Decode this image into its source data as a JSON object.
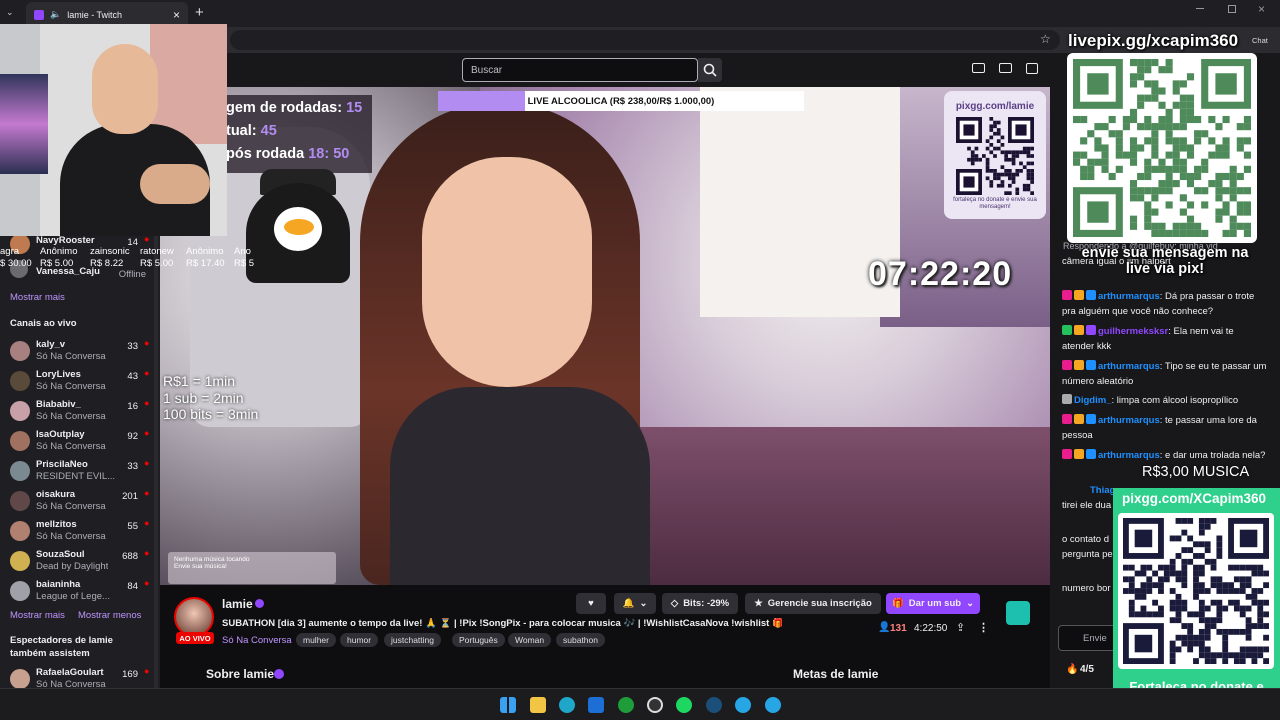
{
  "browser": {
    "tab_title": "lamie - Twitch",
    "new_tab": "+",
    "close": "×"
  },
  "nav": {
    "search_placeholder": "Buscar",
    "chat_label": "Chat"
  },
  "donors": {
    "names": [
      "agra",
      "Anônimo",
      "zainsonic",
      "ratonew",
      "Anônimo",
      "Ano"
    ],
    "amounts": [
      "$ 30.00",
      "R$ 5.00",
      "R$ 8.22",
      "R$ 5.00",
      "R$ 17.40",
      "R$ 5"
    ]
  },
  "sidebar": {
    "followed": [
      {
        "name": "NavyRooster",
        "count": "14"
      },
      {
        "name": "Vanessa_Caju",
        "status": "Offline"
      }
    ],
    "show_more_1": "Mostrar mais",
    "live_title": "Canais ao vivo",
    "live": [
      {
        "name": "kaly_v",
        "game": "Só Na Conversa",
        "count": "33",
        "color": "#a98080"
      },
      {
        "name": "LoryLives",
        "game": "Só Na Conversa",
        "count": "43",
        "color": "#5a4a3a"
      },
      {
        "name": "Biababiv_",
        "game": "Só Na Conversa",
        "count": "16",
        "color": "#c8a0a8"
      },
      {
        "name": "IsaOutplay",
        "game": "Só Na Conversa",
        "count": "92",
        "color": "#a07060"
      },
      {
        "name": "PriscilaNeo",
        "game": "RESIDENT EVIL...",
        "count": "33",
        "color": "#7a8a90"
      },
      {
        "name": "oisakura",
        "game": "Só Na Conversa",
        "count": "201",
        "color": "#604848"
      },
      {
        "name": "mellzitos",
        "game": "Só Na Conversa",
        "count": "55",
        "color": "#b08070"
      },
      {
        "name": "SouzaSoul",
        "game": "Dead by Daylight",
        "count": "688",
        "color": "#d0b050"
      },
      {
        "name": "baianinha",
        "game": "League of Lege...",
        "count": "84",
        "color": "#a0a0a8"
      }
    ],
    "show_more_2": "Mostrar mais",
    "show_less": "Mostrar menos",
    "also_watch_title": "Espectadores de lamie também assistem",
    "also_watch": [
      {
        "name": "RafaelaGoulart",
        "game": "Só Na Conversa",
        "count": "169"
      }
    ]
  },
  "overlay": {
    "stats": [
      {
        "label": "gem de rodadas:",
        "value": "15"
      },
      {
        "label": "tual:",
        "value": "45"
      },
      {
        "label": "pós rodada",
        "value1": "18:",
        "value2": "50"
      }
    ],
    "goal_text": "LIVE ALCOOLICA (R$ 238,00/R$ 1.000,00)",
    "goal_progress": 0.238,
    "timer": "07:22:20",
    "rates": [
      "R$1 = 1min",
      "1 sub = 2min",
      "100 bits = 3min"
    ],
    "music_widget": [
      "Nenhuma música tocando",
      "Envie sua música!"
    ],
    "pixgg_video": {
      "title": "pixgg.com/lamie",
      "caption": "fortaleça no donate e envie sua mensagem!"
    }
  },
  "stream": {
    "streamer": "lamie",
    "live_badge": "AO VIVO",
    "title": "SUBATHON [dia 3] aumente o tempo da live! 🙏 ⏳ | !Pix !SongPix - para colocar musica 🎶 | !WishlistCasaNova !wishlist 🎁",
    "category": "Só Na Conversa",
    "tags": [
      "mulher",
      "humor",
      "justchatting",
      "Português",
      "Woman",
      "subathon"
    ],
    "bits_label": "Bits: -29%",
    "manage_sub": "Gerencie sua inscrição",
    "gift_sub": "Dar um sub",
    "viewers": "131",
    "uptime": "4:22:50",
    "about": "Sobre lamie",
    "goals": "Metas de lamie"
  },
  "chat": {
    "messages": [
      {
        "user": "arthurmarqus",
        "text": ": Dá pra passar o trote pra alguém que você não conhece?"
      },
      {
        "user": "guilhermeksksr",
        "text": ": Ela nem vai te atender kkk"
      },
      {
        "user": "arthurmarqus",
        "text": ": Tipo se eu te passar um número aleatório"
      },
      {
        "user": "Digdim_",
        "text": ": limpa com álcool isopropílico"
      },
      {
        "user": "arthurmarqus",
        "text": ": te passar uma lore da pessoa"
      },
      {
        "user": "arthurmarqus",
        "text": ": e dar uma trolada nela?"
      }
    ],
    "partial": [
      "Respondendo a @guilfebuv: minha vid",
      "câmera igual o jim halpert"
    ],
    "partial_lower": [
      "Thiag",
      "tirei ele dua",
      "o contato d",
      "pergunta pe",
      "numero bor"
    ],
    "input_placeholder": "Envie",
    "points": "4/5"
  },
  "chat_overlay": {
    "qr_big_title": "livepix.gg/xcapim360",
    "qr_big_caption": "envie sua mensagem na live via pix!",
    "musica": "R$3,00 MUSICA",
    "qr_small_title": "pixgg.com/XCapim360",
    "qr_small_caption": "Fortaleça no donate e envie sua mensagem!"
  },
  "taskbar": {
    "icons": [
      "windows-icon",
      "folder-icon",
      "edge-icon",
      "outlook-icon",
      "xbox-icon",
      "obs-icon",
      "spotify-icon",
      "steam-icon",
      "telegram-icon",
      "telegram-icon"
    ]
  },
  "colors": {
    "twitch_purple": "#9146ff",
    "live_red": "#eb0400",
    "goal_fill": "#b38cf2",
    "pix_green": "#2ed08c"
  }
}
